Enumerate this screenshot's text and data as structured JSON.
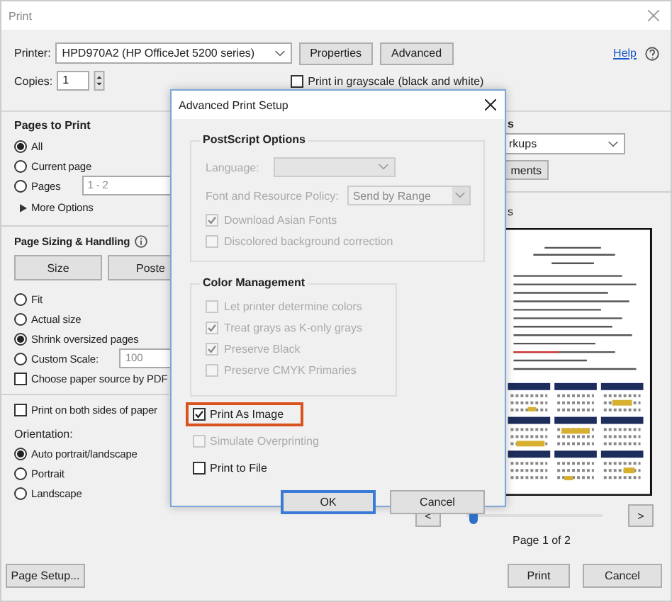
{
  "window": {
    "title": "Print"
  },
  "printer": {
    "label": "Printer:",
    "value": "HPD970A2 (HP OfficeJet 5200 series)",
    "buttons": [
      "Properties",
      "Advanced"
    ],
    "help": "Help"
  },
  "copies": {
    "label": "Copies:",
    "value": "1"
  },
  "grayscale": {
    "label": "Print in grayscale (black and white)",
    "checked": false
  },
  "pages_to_print": {
    "title": "Pages to Print",
    "options": [
      {
        "label": "All",
        "selected": true
      },
      {
        "label": "Current page",
        "selected": false
      },
      {
        "label": "Pages",
        "selected": false,
        "field": "1 - 2"
      }
    ],
    "more_options": "More Options"
  },
  "page_sizing": {
    "title": "Page Sizing & Handling",
    "buttons": [
      "Size",
      "Poste"
    ],
    "options": [
      {
        "label": "Fit",
        "selected": false
      },
      {
        "label": "Actual size",
        "selected": false
      },
      {
        "label": "Shrink oversized pages",
        "selected": true
      },
      {
        "label": "Custom Scale:",
        "selected": false,
        "field": "100"
      }
    ],
    "choose_paper": {
      "label": "Choose paper source by PDF",
      "checked": false
    }
  },
  "both_sides": {
    "label": "Print on both sides of paper",
    "checked": false
  },
  "orientation": {
    "title": "Orientation:",
    "options": [
      {
        "label": "Auto portrait/landscape",
        "selected": true
      },
      {
        "label": "Portrait",
        "selected": false
      },
      {
        "label": "Landscape",
        "selected": false
      }
    ]
  },
  "right_panel": {
    "section_title": "s",
    "dropdown": "rkups",
    "button": "ments",
    "preview_title": "s",
    "prev": "<",
    "next": ">",
    "slider": {
      "level": 0.02
    },
    "page_label": "Page 1 of 2"
  },
  "footer": {
    "page_setup": "Page Setup...",
    "print": "Print",
    "cancel": "Cancel"
  },
  "advanced_dialog": {
    "title": "Advanced Print Setup",
    "postscript": {
      "title": "PostScript Options",
      "language_label": "Language:",
      "policy_label": "Font and Resource Policy:",
      "policy_value": "Send by Range",
      "checkboxes": [
        {
          "label": "Download Asian Fonts",
          "checked": true,
          "disabled": true
        },
        {
          "label": "Discolored background correction",
          "checked": false,
          "disabled": true
        }
      ]
    },
    "color_management": {
      "title": "Color Management",
      "checkboxes": [
        {
          "label": "Let printer determine colors",
          "checked": false,
          "disabled": true
        },
        {
          "label": "Treat grays as K-only grays",
          "checked": true,
          "disabled": true
        },
        {
          "label": "Preserve Black",
          "checked": true,
          "disabled": true
        },
        {
          "label": "Preserve CMYK Primaries",
          "checked": false,
          "disabled": true
        }
      ]
    },
    "options": [
      {
        "label": "Print As Image",
        "checked": true,
        "disabled": false,
        "highlighted": true
      },
      {
        "label": "Simulate Overprinting",
        "checked": false,
        "disabled": true,
        "highlighted": false
      },
      {
        "label": "Print to File",
        "checked": false,
        "disabled": false,
        "highlighted": false
      }
    ],
    "buttons": [
      {
        "label": "OK",
        "default": true
      },
      {
        "label": "Cancel",
        "default": false
      }
    ]
  }
}
